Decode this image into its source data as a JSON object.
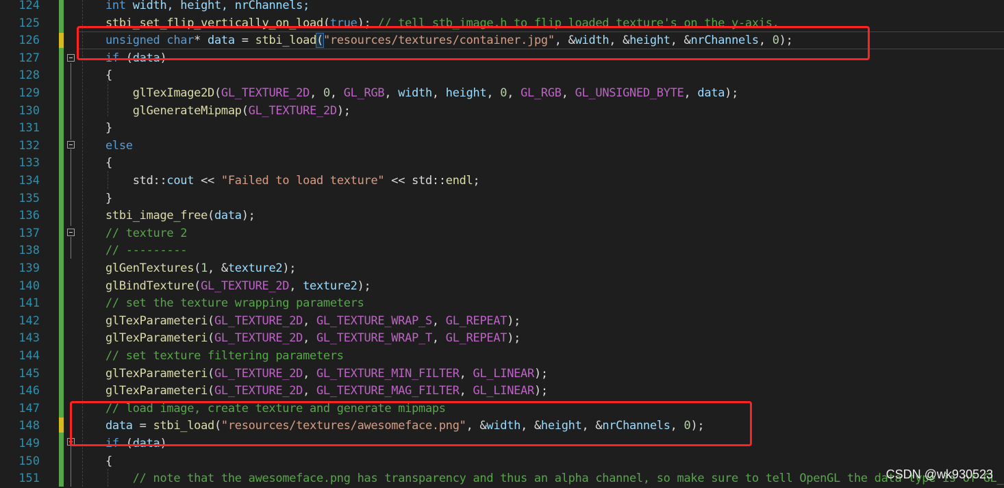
{
  "editor": {
    "lines": [
      {
        "num": "124",
        "code": [
          {
            "t": "int",
            "c": "kw"
          },
          {
            "t": " width, height, nrChannels;",
            "c": "var"
          }
        ]
      },
      {
        "num": "125",
        "code": [
          {
            "t": "stbi_set_flip_vertically_on_load",
            "c": "fn"
          },
          {
            "t": "(",
            "c": "plain"
          },
          {
            "t": "true",
            "c": "kw"
          },
          {
            "t": "); ",
            "c": "plain"
          },
          {
            "t": "// tell stb_image.h to flip loaded texture's on the y-axis.",
            "c": "cm"
          }
        ]
      },
      {
        "num": "126",
        "code": [
          {
            "t": "unsigned",
            "c": "kw"
          },
          {
            "t": " ",
            "c": "plain"
          },
          {
            "t": "char",
            "c": "kw"
          },
          {
            "t": "* ",
            "c": "plain"
          },
          {
            "t": "data",
            "c": "var"
          },
          {
            "t": " = ",
            "c": "plain"
          },
          {
            "t": "stbi_load",
            "c": "fn"
          },
          {
            "t": "(",
            "c": "paren"
          },
          {
            "t": "\"resources/textures/container.jpg\"",
            "c": "str"
          },
          {
            "t": ", &",
            "c": "plain"
          },
          {
            "t": "width",
            "c": "var"
          },
          {
            "t": ", &",
            "c": "plain"
          },
          {
            "t": "height",
            "c": "var"
          },
          {
            "t": ", &",
            "c": "plain"
          },
          {
            "t": "nrChannels",
            "c": "var"
          },
          {
            "t": ", ",
            "c": "plain"
          },
          {
            "t": "0",
            "c": "num"
          },
          {
            "t": ");",
            "c": "plain"
          }
        ]
      },
      {
        "num": "127",
        "code": [
          {
            "t": "if",
            "c": "kw"
          },
          {
            "t": " (",
            "c": "plain"
          },
          {
            "t": "data",
            "c": "var"
          },
          {
            "t": ")",
            "c": "plain"
          }
        ]
      },
      {
        "num": "128",
        "code": [
          {
            "t": "{",
            "c": "plain"
          }
        ]
      },
      {
        "num": "129",
        "code": [
          {
            "t": "    ",
            "c": "plain"
          },
          {
            "t": "glTexImage2D",
            "c": "fn"
          },
          {
            "t": "(",
            "c": "plain"
          },
          {
            "t": "GL_TEXTURE_2D",
            "c": "mac"
          },
          {
            "t": ", ",
            "c": "plain"
          },
          {
            "t": "0",
            "c": "num"
          },
          {
            "t": ", ",
            "c": "plain"
          },
          {
            "t": "GL_RGB",
            "c": "mac"
          },
          {
            "t": ", ",
            "c": "plain"
          },
          {
            "t": "width",
            "c": "var"
          },
          {
            "t": ", ",
            "c": "plain"
          },
          {
            "t": "height",
            "c": "var"
          },
          {
            "t": ", ",
            "c": "plain"
          },
          {
            "t": "0",
            "c": "num"
          },
          {
            "t": ", ",
            "c": "plain"
          },
          {
            "t": "GL_RGB",
            "c": "mac"
          },
          {
            "t": ", ",
            "c": "plain"
          },
          {
            "t": "GL_UNSIGNED_BYTE",
            "c": "mac"
          },
          {
            "t": ", ",
            "c": "plain"
          },
          {
            "t": "data",
            "c": "var"
          },
          {
            "t": ");",
            "c": "plain"
          }
        ]
      },
      {
        "num": "130",
        "code": [
          {
            "t": "    ",
            "c": "plain"
          },
          {
            "t": "glGenerateMipmap",
            "c": "fn"
          },
          {
            "t": "(",
            "c": "plain"
          },
          {
            "t": "GL_TEXTURE_2D",
            "c": "mac"
          },
          {
            "t": ");",
            "c": "plain"
          }
        ]
      },
      {
        "num": "131",
        "code": [
          {
            "t": "}",
            "c": "plain"
          }
        ]
      },
      {
        "num": "132",
        "code": [
          {
            "t": "else",
            "c": "kw"
          }
        ]
      },
      {
        "num": "133",
        "code": [
          {
            "t": "{",
            "c": "plain"
          }
        ]
      },
      {
        "num": "134",
        "code": [
          {
            "t": "    std::",
            "c": "plain"
          },
          {
            "t": "cout",
            "c": "var"
          },
          {
            "t": " << ",
            "c": "plain"
          },
          {
            "t": "\"Failed to load texture\"",
            "c": "str"
          },
          {
            "t": " << std::",
            "c": "plain"
          },
          {
            "t": "endl",
            "c": "fn"
          },
          {
            "t": ";",
            "c": "plain"
          }
        ]
      },
      {
        "num": "135",
        "code": [
          {
            "t": "}",
            "c": "plain"
          }
        ]
      },
      {
        "num": "136",
        "code": [
          {
            "t": "stbi_image_free",
            "c": "fn"
          },
          {
            "t": "(",
            "c": "plain"
          },
          {
            "t": "data",
            "c": "var"
          },
          {
            "t": ");",
            "c": "plain"
          }
        ]
      },
      {
        "num": "137",
        "code": [
          {
            "t": "// texture 2",
            "c": "cm"
          }
        ]
      },
      {
        "num": "138",
        "code": [
          {
            "t": "// ---------",
            "c": "cm"
          }
        ]
      },
      {
        "num": "139",
        "code": [
          {
            "t": "glGenTextures",
            "c": "fn"
          },
          {
            "t": "(",
            "c": "plain"
          },
          {
            "t": "1",
            "c": "num"
          },
          {
            "t": ", &",
            "c": "plain"
          },
          {
            "t": "texture2",
            "c": "var"
          },
          {
            "t": ");",
            "c": "plain"
          }
        ]
      },
      {
        "num": "140",
        "code": [
          {
            "t": "glBindTexture",
            "c": "fn"
          },
          {
            "t": "(",
            "c": "plain"
          },
          {
            "t": "GL_TEXTURE_2D",
            "c": "mac"
          },
          {
            "t": ", ",
            "c": "plain"
          },
          {
            "t": "texture2",
            "c": "var"
          },
          {
            "t": ");",
            "c": "plain"
          }
        ]
      },
      {
        "num": "141",
        "code": [
          {
            "t": "// set the texture wrapping parameters",
            "c": "cm"
          }
        ]
      },
      {
        "num": "142",
        "code": [
          {
            "t": "glTexParameteri",
            "c": "fn"
          },
          {
            "t": "(",
            "c": "plain"
          },
          {
            "t": "GL_TEXTURE_2D",
            "c": "mac"
          },
          {
            "t": ", ",
            "c": "plain"
          },
          {
            "t": "GL_TEXTURE_WRAP_S",
            "c": "mac"
          },
          {
            "t": ", ",
            "c": "plain"
          },
          {
            "t": "GL_REPEAT",
            "c": "mac"
          },
          {
            "t": ");",
            "c": "plain"
          }
        ]
      },
      {
        "num": "143",
        "code": [
          {
            "t": "glTexParameteri",
            "c": "fn"
          },
          {
            "t": "(",
            "c": "plain"
          },
          {
            "t": "GL_TEXTURE_2D",
            "c": "mac"
          },
          {
            "t": ", ",
            "c": "plain"
          },
          {
            "t": "GL_TEXTURE_WRAP_T",
            "c": "mac"
          },
          {
            "t": ", ",
            "c": "plain"
          },
          {
            "t": "GL_REPEAT",
            "c": "mac"
          },
          {
            "t": ");",
            "c": "plain"
          }
        ]
      },
      {
        "num": "144",
        "code": [
          {
            "t": "// set texture filtering parameters",
            "c": "cm"
          }
        ]
      },
      {
        "num": "145",
        "code": [
          {
            "t": "glTexParameteri",
            "c": "fn"
          },
          {
            "t": "(",
            "c": "plain"
          },
          {
            "t": "GL_TEXTURE_2D",
            "c": "mac"
          },
          {
            "t": ", ",
            "c": "plain"
          },
          {
            "t": "GL_TEXTURE_MIN_FILTER",
            "c": "mac"
          },
          {
            "t": ", ",
            "c": "plain"
          },
          {
            "t": "GL_LINEAR",
            "c": "mac"
          },
          {
            "t": ");",
            "c": "plain"
          }
        ]
      },
      {
        "num": "146",
        "code": [
          {
            "t": "glTexParameteri",
            "c": "fn"
          },
          {
            "t": "(",
            "c": "plain"
          },
          {
            "t": "GL_TEXTURE_2D",
            "c": "mac"
          },
          {
            "t": ", ",
            "c": "plain"
          },
          {
            "t": "GL_TEXTURE_MAG_FILTER",
            "c": "mac"
          },
          {
            "t": ", ",
            "c": "plain"
          },
          {
            "t": "GL_LINEAR",
            "c": "mac"
          },
          {
            "t": ");",
            "c": "plain"
          }
        ]
      },
      {
        "num": "147",
        "code": [
          {
            "t": "// load image, create texture and generate mipmaps",
            "c": "cm"
          }
        ]
      },
      {
        "num": "148",
        "code": [
          {
            "t": "data",
            "c": "var"
          },
          {
            "t": " = ",
            "c": "plain"
          },
          {
            "t": "stbi_load",
            "c": "fn"
          },
          {
            "t": "(",
            "c": "plain"
          },
          {
            "t": "\"resources/textures/awesomeface.png\"",
            "c": "str"
          },
          {
            "t": ", &",
            "c": "plain"
          },
          {
            "t": "width",
            "c": "var"
          },
          {
            "t": ", &",
            "c": "plain"
          },
          {
            "t": "height",
            "c": "var"
          },
          {
            "t": ", &",
            "c": "plain"
          },
          {
            "t": "nrChannels",
            "c": "var"
          },
          {
            "t": ", ",
            "c": "plain"
          },
          {
            "t": "0",
            "c": "num"
          },
          {
            "t": ");",
            "c": "plain"
          }
        ]
      },
      {
        "num": "149",
        "code": [
          {
            "t": "if",
            "c": "kw"
          },
          {
            "t": " (",
            "c": "plain"
          },
          {
            "t": "data",
            "c": "var"
          },
          {
            "t": ")",
            "c": "plain"
          }
        ]
      },
      {
        "num": "150",
        "code": [
          {
            "t": "{",
            "c": "plain"
          }
        ]
      },
      {
        "num": "151",
        "code": [
          {
            "t": "    ",
            "c": "plain"
          },
          {
            "t": "// note that the awesomeface.png has transparency and thus an alpha channel, so make sure to tell OpenGL the data type is of GL_RGBA",
            "c": "cm"
          }
        ]
      }
    ]
  },
  "colors": {
    "background": "#1e1e1e",
    "line_number": "#2b91af",
    "keyword": "#569cd6",
    "function": "#dcdcaa",
    "string": "#d69d85",
    "comment": "#57a64a",
    "macro": "#bd63c5",
    "variable": "#9cdcfe",
    "highlight_box": "#ff2222",
    "change_bar": "#57a64a",
    "modified_mark": "#d7ba1d"
  },
  "watermark": "CSDN @wk930523"
}
